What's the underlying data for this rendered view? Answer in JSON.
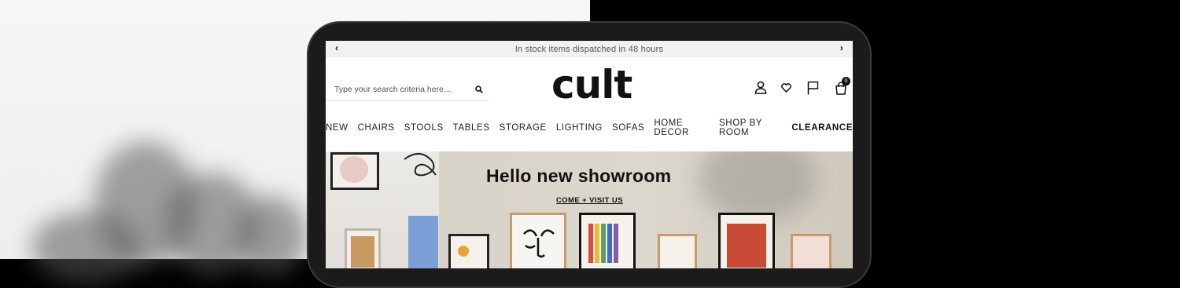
{
  "announcement": {
    "text": "In stock items dispatched in 48 hours",
    "prev_icon": "chevron-left-icon",
    "next_icon": "chevron-right-icon"
  },
  "search": {
    "placeholder": "Type your search criteria here...",
    "icon": "search-icon"
  },
  "logo": {
    "text": "cult"
  },
  "header_icons": {
    "account": "user-icon",
    "wishlist": "heart-icon",
    "flag": "flag-icon",
    "cart": "cart-icon",
    "cart_count": "0"
  },
  "nav": {
    "items": [
      "NEW",
      "CHAIRS",
      "STOOLS",
      "TABLES",
      "STORAGE",
      "LIGHTING",
      "SOFAS",
      "HOME DECOR",
      "SHOP BY ROOM"
    ],
    "clearance": "CLEARANCE"
  },
  "hero": {
    "title": "Hello new showroom",
    "link": "COME + VISIT US"
  },
  "colors": {
    "accent": "#111111",
    "announce_bg": "#f1f1f1",
    "hero_bg": "#d8d3c9"
  }
}
